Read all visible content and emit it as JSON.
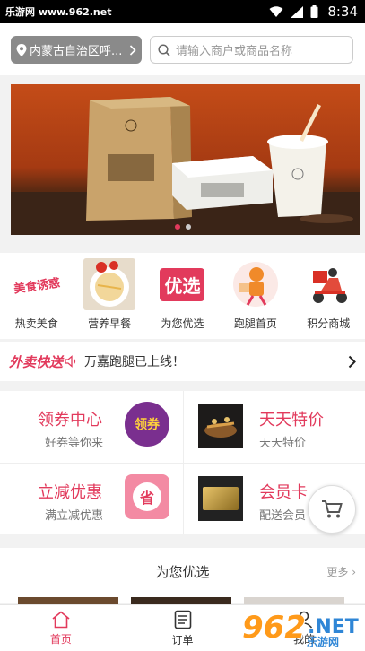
{
  "status_bar": {
    "watermark": "乐游网 www.962.net",
    "time": "8:34"
  },
  "header": {
    "location": "内蒙古自治区呼...",
    "search_placeholder": "请输入商户或商品名称"
  },
  "banner": {
    "slide_count": 2,
    "active_index": 0
  },
  "categories": [
    {
      "label": "热卖美食",
      "icon": "food-logo-icon",
      "image_text": "美食诱惑"
    },
    {
      "label": "营养早餐",
      "icon": "rice-dish-icon"
    },
    {
      "label": "为您优选",
      "icon": "choice-tag-icon",
      "image_text": "优选"
    },
    {
      "label": "跑腿首页",
      "icon": "runner-icon"
    },
    {
      "label": "积分商城",
      "icon": "delivery-scooter-icon"
    }
  ],
  "ticker": {
    "brand": "外卖快送",
    "message": "万嘉跑腿已上线！"
  },
  "promos": [
    {
      "title": "领券中心",
      "subtitle": "好券等你来",
      "badge": "领券"
    },
    {
      "title": "天天特价",
      "subtitle": "天天特价"
    },
    {
      "title": "立减优惠",
      "subtitle": "满立减优惠",
      "badge": "省"
    },
    {
      "title": "会员卡",
      "subtitle": "配送会员"
    }
  ],
  "section": {
    "title": "为您优选",
    "more": "更多"
  },
  "tabs": [
    {
      "label": "首页",
      "active": true
    },
    {
      "label": "订单",
      "active": false
    },
    {
      "label": "我的",
      "active": false
    }
  ],
  "overlay_watermark": {
    "big": "962",
    "net": ".NET",
    "sub": "乐游网"
  },
  "colors": {
    "accent": "#e23a5c",
    "location_bg": "#8a8a8a",
    "banner_bg": "#b8461a"
  }
}
